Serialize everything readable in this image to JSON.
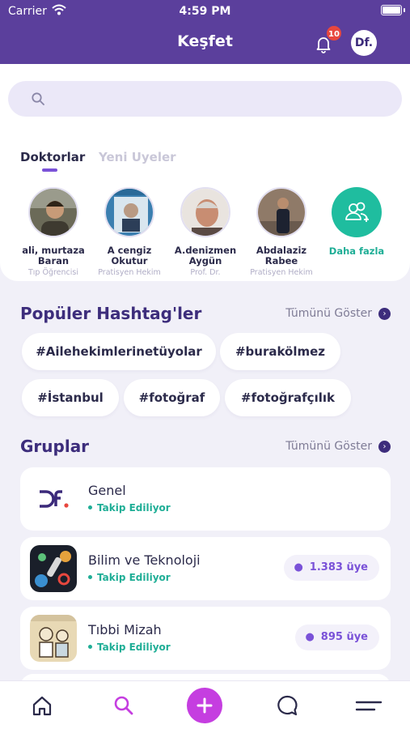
{
  "status_bar": {
    "carrier": "Carrier",
    "time": "4:59 PM"
  },
  "header": {
    "title": "Keşfet",
    "notification_count": "10",
    "avatar_text": "Df."
  },
  "search": {
    "placeholder": ""
  },
  "tabs": [
    {
      "label": "Doktorlar",
      "active": true
    },
    {
      "label": "Yeni Uyeler",
      "active": false
    }
  ],
  "doctors": [
    {
      "name": "ali, murtaza Baran",
      "title": "Tıp Öğrencisi"
    },
    {
      "name": "A cengiz Okutur",
      "title": "Pratisyen Hekim"
    },
    {
      "name": "A.denizmen Aygün",
      "title": "Prof. Dr."
    },
    {
      "name": "Abdalaziz Rabee",
      "title": "Pratisyen Hekim"
    }
  ],
  "more_label": "Daha fazla",
  "hashtags_section": {
    "title": "Popüler Hashtag'ler",
    "see_all": "Tümünü Göster",
    "tags": [
      "#Ailehekimlerinetüyolar",
      "#burakölmez",
      "#İstanbul",
      "#fotoğraf",
      "#fotoğrafçılık"
    ]
  },
  "groups_section": {
    "title": "Gruplar",
    "see_all": "Tümünü Göster",
    "groups": [
      {
        "name": "Genel",
        "status": "Takip Ediliyor",
        "members": ""
      },
      {
        "name": "Bilim ve Teknoloji",
        "status": "Takip Ediliyor",
        "members": "1.383 üye"
      },
      {
        "name": "Tıbbi Mizah",
        "status": "Takip Ediliyor",
        "members": "895 üye"
      }
    ]
  },
  "bottom_nav": [
    "home-icon",
    "search-icon",
    "add-icon",
    "chat-icon",
    "menu-icon"
  ],
  "colors": {
    "header": "#5b3f9c",
    "accent": "#7a52d8",
    "teal": "#1fae96",
    "add_button": "#c53ee0",
    "badge": "#e8473e"
  }
}
